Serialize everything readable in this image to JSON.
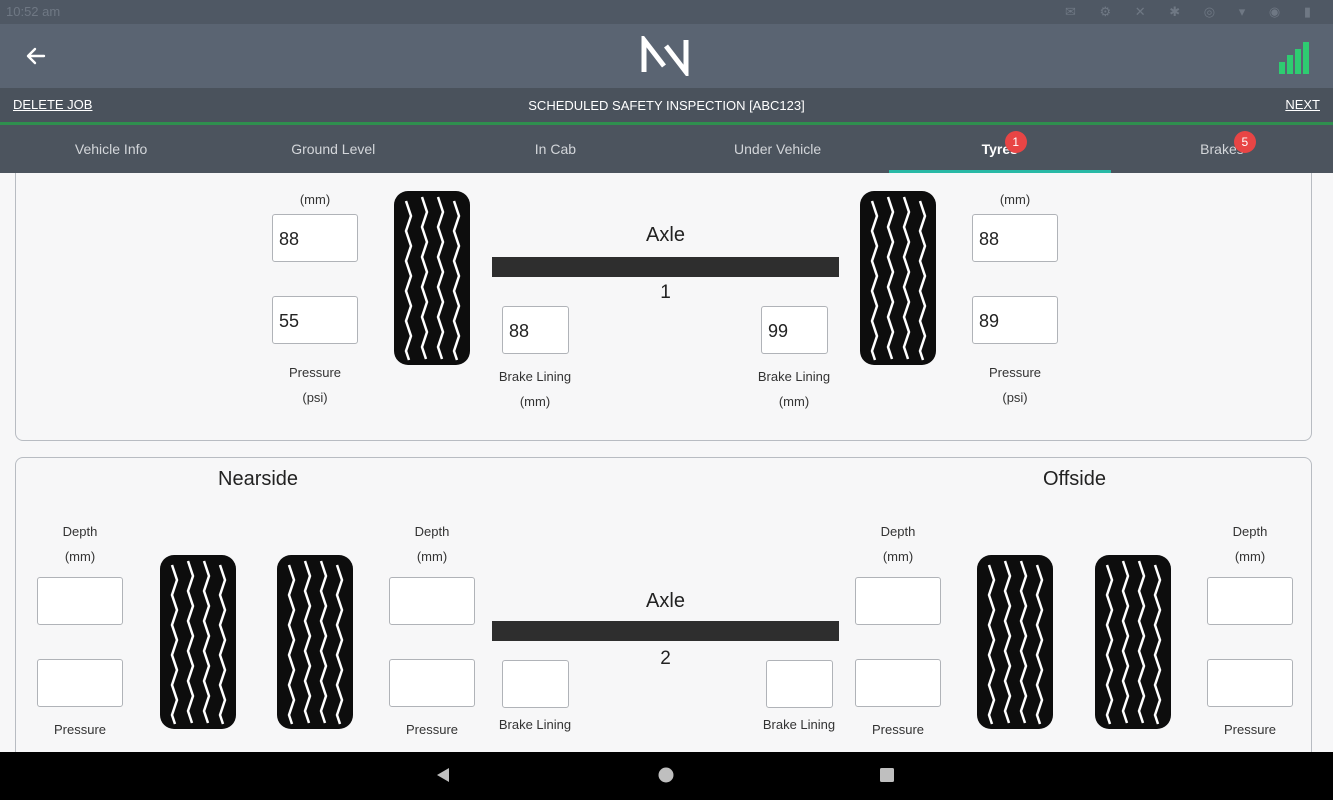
{
  "status": {
    "time": "10:52 am",
    "icons": "✉ ⚙ ✕   ✱ ◎ ▾ ◉ ▮"
  },
  "header": {
    "job_title": "SCHEDULED SAFETY INSPECTION [ABC123]",
    "delete_label": "DELETE JOB",
    "next_label": "NEXT"
  },
  "tabs": [
    {
      "label": "Vehicle Info"
    },
    {
      "label": "Ground Level"
    },
    {
      "label": "In Cab"
    },
    {
      "label": "Under Vehicle"
    },
    {
      "label": "Tyres",
      "badge": "1",
      "active": true
    },
    {
      "label": "Brakes",
      "badge": "5"
    }
  ],
  "labels": {
    "mm": "(mm)",
    "psi": "(psi)",
    "pressure": "Pressure",
    "depth": "Depth",
    "brake_lining": "Brake Lining",
    "axle": "Axle",
    "nearside": "Nearside",
    "offside": "Offside"
  },
  "axle1": {
    "number": "1",
    "left_depth": "88",
    "left_pressure": "55",
    "right_depth": "88",
    "right_pressure": "89",
    "left_brake": "88",
    "right_brake": "99"
  },
  "axle2": {
    "number": "2"
  },
  "colors": {
    "accent": "#29b9a6",
    "badge": "#e84545",
    "signal": "#2ecc71",
    "appbar": "#5a6472"
  }
}
